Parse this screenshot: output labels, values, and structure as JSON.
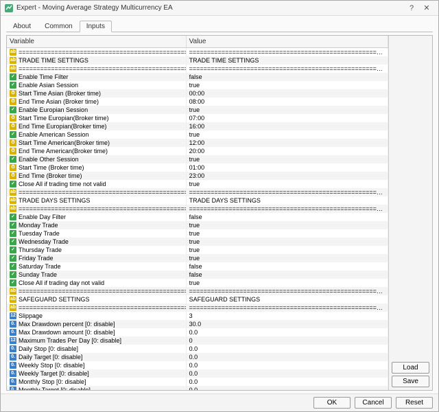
{
  "window": {
    "title": "Expert - Moving Average Strategy Multicurrency EA"
  },
  "tabs": {
    "items": [
      "About",
      "Common",
      "Inputs"
    ],
    "active": 2
  },
  "columns": {
    "variable": "Variable",
    "value": "Value"
  },
  "sidebar": {
    "load": "Load",
    "save": "Save"
  },
  "footer": {
    "ok": "OK",
    "cancel": "Cancel",
    "reset": "Reset"
  },
  "sep": "========================================================================",
  "rows": [
    {
      "t": "str",
      "var": "",
      "val": "",
      "sepRow": true
    },
    {
      "t": "str",
      "var": "TRADE TIME SETTINGS",
      "val": "TRADE TIME SETTINGS"
    },
    {
      "t": "str",
      "var": "",
      "val": "",
      "sepRow": true
    },
    {
      "t": "bool",
      "var": "Enable Time Filter",
      "val": "false"
    },
    {
      "t": "bool",
      "var": "Enable Asian Session",
      "val": "true"
    },
    {
      "t": "time",
      "var": "Start Time Asian (Broker time)",
      "val": "00:00"
    },
    {
      "t": "time",
      "var": "End Time Asian (Broker time)",
      "val": "08:00"
    },
    {
      "t": "bool",
      "var": "Enable Europian Session",
      "val": "true"
    },
    {
      "t": "time",
      "var": "Start Time Europian(Broker time)",
      "val": "07:00"
    },
    {
      "t": "time",
      "var": "End Time Europian(Broker time)",
      "val": "16:00"
    },
    {
      "t": "bool",
      "var": "Enable American Session",
      "val": "true"
    },
    {
      "t": "time",
      "var": "Start Time American(Broker time)",
      "val": "12:00"
    },
    {
      "t": "time",
      "var": "End Time American(Broker time)",
      "val": "20:00"
    },
    {
      "t": "bool",
      "var": "Enable Other Session",
      "val": "true"
    },
    {
      "t": "time",
      "var": "Start Time (Broker time)",
      "val": "01:00"
    },
    {
      "t": "time",
      "var": "End Time (Broker time)",
      "val": "23:00"
    },
    {
      "t": "bool",
      "var": "Close All if trading time not valid",
      "val": "true"
    },
    {
      "t": "str",
      "var": "",
      "val": "",
      "sepRow": true
    },
    {
      "t": "str",
      "var": "TRADE DAYS SETTINGS",
      "val": "TRADE DAYS SETTINGS"
    },
    {
      "t": "str",
      "var": "",
      "val": "",
      "sepRow": true
    },
    {
      "t": "bool",
      "var": "Enable Day Filter",
      "val": "false"
    },
    {
      "t": "bool",
      "var": "Monday Trade",
      "val": "true"
    },
    {
      "t": "bool",
      "var": "Tuesday Trade",
      "val": "true"
    },
    {
      "t": "bool",
      "var": "Wednesday Trade",
      "val": "true"
    },
    {
      "t": "bool",
      "var": "Thursday Trade",
      "val": "true"
    },
    {
      "t": "bool",
      "var": "Friday Trade",
      "val": "true"
    },
    {
      "t": "bool",
      "var": "Saturday Trade",
      "val": "false"
    },
    {
      "t": "bool",
      "var": "Sunday Trade",
      "val": "false"
    },
    {
      "t": "bool",
      "var": "Close All if trading day not valid",
      "val": "true"
    },
    {
      "t": "str",
      "var": "",
      "val": "",
      "sepRow": true
    },
    {
      "t": "str",
      "var": "SAFEGUARD SETTINGS",
      "val": "SAFEGUARD SETTINGS"
    },
    {
      "t": "str",
      "var": "",
      "val": "",
      "sepRow": true
    },
    {
      "t": "int",
      "var": "Slippage",
      "val": "3"
    },
    {
      "t": "dbl",
      "var": "Max Drawdown percent [0: disable]",
      "val": "30.0"
    },
    {
      "t": "dbl",
      "var": "Max Drawdown amount [0: disable]",
      "val": "0.0"
    },
    {
      "t": "int",
      "var": "Maximum Trades Per Day [0: disable]",
      "val": "0"
    },
    {
      "t": "dbl",
      "var": "Daily Stop [0: disable]",
      "val": "0.0"
    },
    {
      "t": "dbl",
      "var": "Daily Target [0: disable]",
      "val": "0.0"
    },
    {
      "t": "dbl",
      "var": "Weekly Stop [0: disable]",
      "val": "0.0"
    },
    {
      "t": "dbl",
      "var": "Weekly Target [0: disable]",
      "val": "0.0"
    },
    {
      "t": "dbl",
      "var": "Monthly Stop [0: disable]",
      "val": "0.0"
    },
    {
      "t": "dbl",
      "var": "Monthly Target [0: disable]",
      "val": "0.0"
    },
    {
      "t": "str",
      "var": "",
      "val": "",
      "sepRow": true
    }
  ],
  "typeGlyph": {
    "str": "ab",
    "bool": "✓",
    "time": "⏱",
    "int": "12",
    "dbl": "0."
  }
}
